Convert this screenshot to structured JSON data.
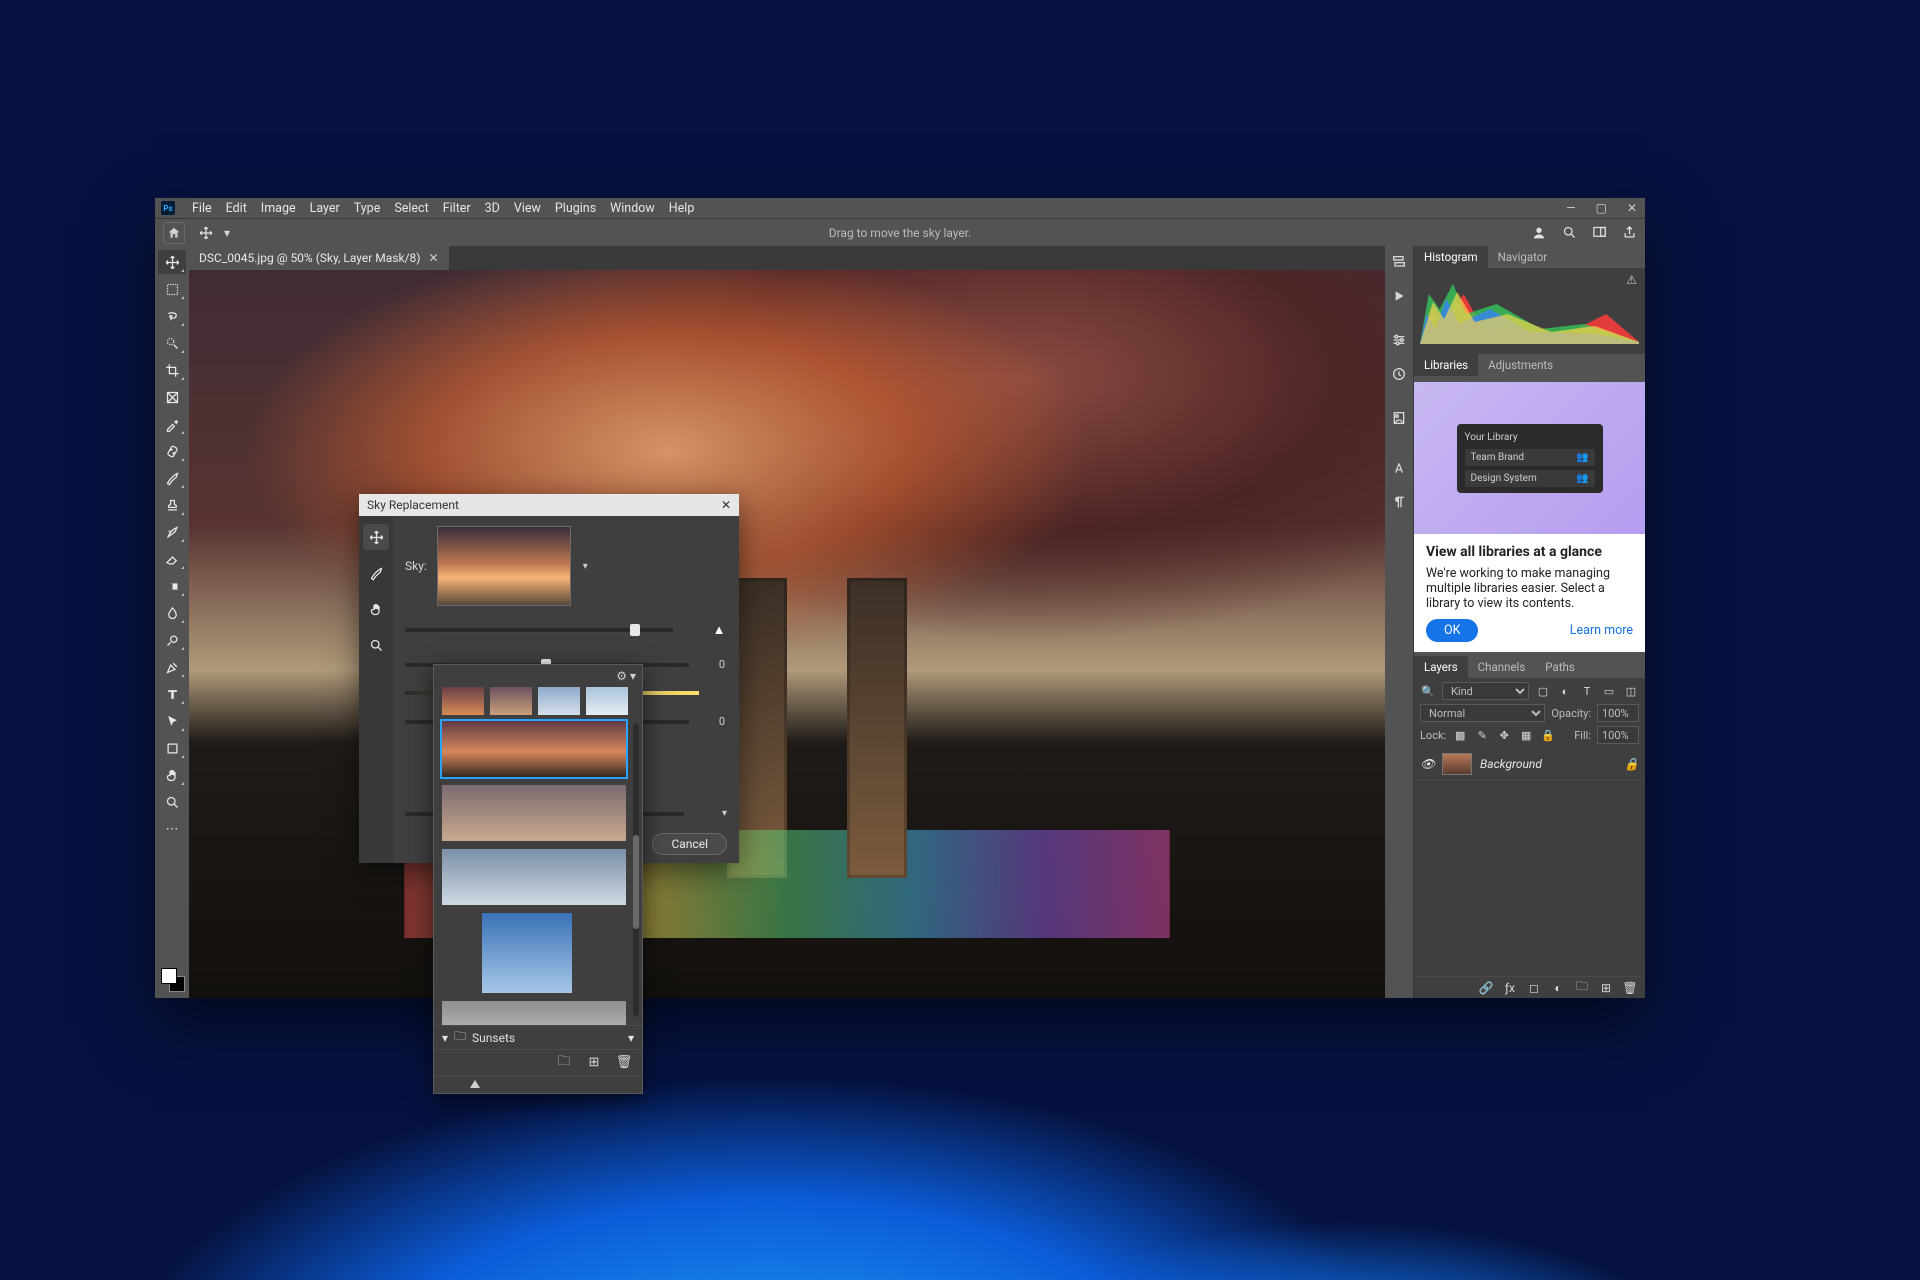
{
  "menubar": {
    "items": [
      "File",
      "Edit",
      "Image",
      "Layer",
      "Type",
      "Select",
      "Filter",
      "3D",
      "View",
      "Plugins",
      "Window",
      "Help"
    ]
  },
  "options": {
    "hint": "Drag to move the sky layer."
  },
  "document": {
    "tab_title": "DSC_0045.jpg @ 50% (Sky, Layer Mask/8)"
  },
  "dialog": {
    "title": "Sky Replacement",
    "sky_label": "Sky:",
    "cancel": "Cancel",
    "slider3_value": "0"
  },
  "dropdown": {
    "folder_name": "Sunsets"
  },
  "panels": {
    "histogram_tab": "Histogram",
    "navigator_tab": "Navigator",
    "libraries_tab": "Libraries",
    "adjustments_tab": "Adjustments",
    "lib_mini_header": "Your Library",
    "lib_mini_row1": "Team Brand",
    "lib_mini_row2": "Design System",
    "lib_title": "View all libraries at a glance",
    "lib_body": "We're working to make managing multiple libraries easier. Select a library to view its contents.",
    "lib_ok": "OK",
    "lib_learn": "Learn more",
    "layers_tab": "Layers",
    "channels_tab": "Channels",
    "paths_tab": "Paths",
    "kind_label": "Kind",
    "blend_mode": "Normal",
    "opacity_label": "Opacity:",
    "opacity_value": "100%",
    "lock_label": "Lock:",
    "fill_label": "Fill:",
    "fill_value": "100%",
    "background_layer": "Background"
  }
}
